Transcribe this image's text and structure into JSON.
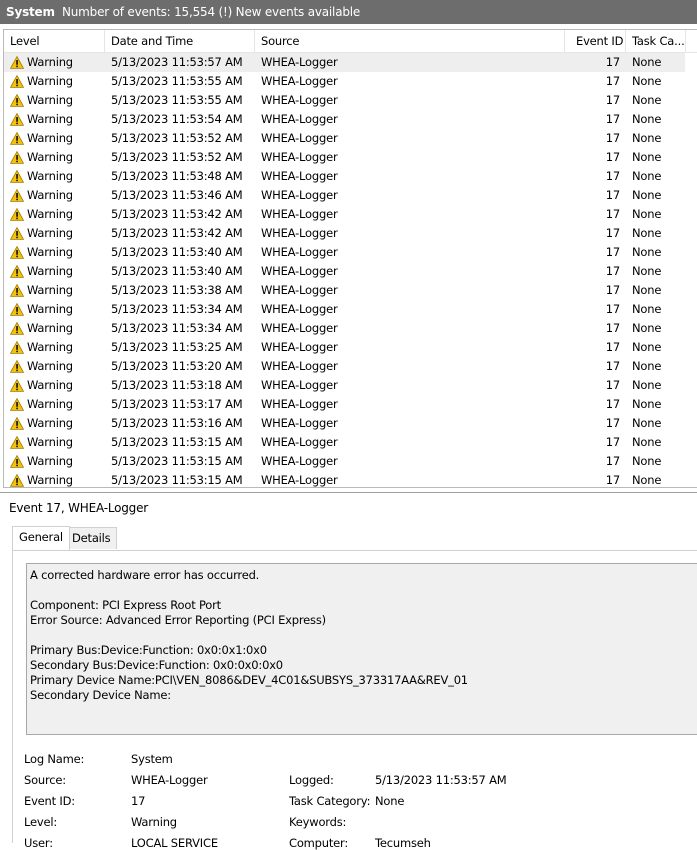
{
  "header": {
    "log_title": "System",
    "event_count_info": "Number of events: 15,554 (!) New events available"
  },
  "columns": [
    "Level",
    "Date and Time",
    "Source",
    "Event ID",
    "Task Ca..."
  ],
  "icons": {
    "warning": "warning-triangle-icon",
    "warning_color": "#f4c20d"
  },
  "events": [
    {
      "level": "Warning",
      "datetime": "5/13/2023 11:53:57 AM",
      "source": "WHEA-Logger",
      "event_id": "17",
      "task": "None"
    },
    {
      "level": "Warning",
      "datetime": "5/13/2023 11:53:55 AM",
      "source": "WHEA-Logger",
      "event_id": "17",
      "task": "None"
    },
    {
      "level": "Warning",
      "datetime": "5/13/2023 11:53:55 AM",
      "source": "WHEA-Logger",
      "event_id": "17",
      "task": "None"
    },
    {
      "level": "Warning",
      "datetime": "5/13/2023 11:53:54 AM",
      "source": "WHEA-Logger",
      "event_id": "17",
      "task": "None"
    },
    {
      "level": "Warning",
      "datetime": "5/13/2023 11:53:52 AM",
      "source": "WHEA-Logger",
      "event_id": "17",
      "task": "None"
    },
    {
      "level": "Warning",
      "datetime": "5/13/2023 11:53:52 AM",
      "source": "WHEA-Logger",
      "event_id": "17",
      "task": "None"
    },
    {
      "level": "Warning",
      "datetime": "5/13/2023 11:53:48 AM",
      "source": "WHEA-Logger",
      "event_id": "17",
      "task": "None"
    },
    {
      "level": "Warning",
      "datetime": "5/13/2023 11:53:46 AM",
      "source": "WHEA-Logger",
      "event_id": "17",
      "task": "None"
    },
    {
      "level": "Warning",
      "datetime": "5/13/2023 11:53:42 AM",
      "source": "WHEA-Logger",
      "event_id": "17",
      "task": "None"
    },
    {
      "level": "Warning",
      "datetime": "5/13/2023 11:53:42 AM",
      "source": "WHEA-Logger",
      "event_id": "17",
      "task": "None"
    },
    {
      "level": "Warning",
      "datetime": "5/13/2023 11:53:40 AM",
      "source": "WHEA-Logger",
      "event_id": "17",
      "task": "None"
    },
    {
      "level": "Warning",
      "datetime": "5/13/2023 11:53:40 AM",
      "source": "WHEA-Logger",
      "event_id": "17",
      "task": "None"
    },
    {
      "level": "Warning",
      "datetime": "5/13/2023 11:53:38 AM",
      "source": "WHEA-Logger",
      "event_id": "17",
      "task": "None"
    },
    {
      "level": "Warning",
      "datetime": "5/13/2023 11:53:34 AM",
      "source": "WHEA-Logger",
      "event_id": "17",
      "task": "None"
    },
    {
      "level": "Warning",
      "datetime": "5/13/2023 11:53:34 AM",
      "source": "WHEA-Logger",
      "event_id": "17",
      "task": "None"
    },
    {
      "level": "Warning",
      "datetime": "5/13/2023 11:53:25 AM",
      "source": "WHEA-Logger",
      "event_id": "17",
      "task": "None"
    },
    {
      "level": "Warning",
      "datetime": "5/13/2023 11:53:20 AM",
      "source": "WHEA-Logger",
      "event_id": "17",
      "task": "None"
    },
    {
      "level": "Warning",
      "datetime": "5/13/2023 11:53:18 AM",
      "source": "WHEA-Logger",
      "event_id": "17",
      "task": "None"
    },
    {
      "level": "Warning",
      "datetime": "5/13/2023 11:53:17 AM",
      "source": "WHEA-Logger",
      "event_id": "17",
      "task": "None"
    },
    {
      "level": "Warning",
      "datetime": "5/13/2023 11:53:16 AM",
      "source": "WHEA-Logger",
      "event_id": "17",
      "task": "None"
    },
    {
      "level": "Warning",
      "datetime": "5/13/2023 11:53:15 AM",
      "source": "WHEA-Logger",
      "event_id": "17",
      "task": "None"
    },
    {
      "level": "Warning",
      "datetime": "5/13/2023 11:53:15 AM",
      "source": "WHEA-Logger",
      "event_id": "17",
      "task": "None"
    },
    {
      "level": "Warning",
      "datetime": "5/13/2023 11:53:15 AM",
      "source": "WHEA-Logger",
      "event_id": "17",
      "task": "None"
    }
  ],
  "detail": {
    "title": "Event 17, WHEA-Logger",
    "tabs": [
      "General",
      "Details"
    ],
    "message_lines": [
      "A corrected hardware error has occurred.",
      "",
      "Component: PCI Express Root Port",
      "Error Source: Advanced Error Reporting (PCI Express)",
      "",
      "Primary Bus:Device:Function: 0x0:0x1:0x0",
      "Secondary Bus:Device:Function: 0x0:0x0:0x0",
      "Primary Device Name:PCI\\VEN_8086&DEV_4C01&SUBSYS_373317AA&REV_01",
      "Secondary Device Name:"
    ],
    "props": {
      "log_name_label": "Log Name:",
      "log_name_value": "System",
      "source_label": "Source:",
      "source_value": "WHEA-Logger",
      "logged_label": "Logged:",
      "logged_value": "5/13/2023 11:53:57 AM",
      "event_id_label": "Event ID:",
      "event_id_value": "17",
      "task_category_label": "Task Category:",
      "task_category_value": "None",
      "level_label": "Level:",
      "level_value": "Warning",
      "keywords_label": "Keywords:",
      "keywords_value": "",
      "user_label": "User:",
      "user_value": "LOCAL SERVICE",
      "computer_label": "Computer:",
      "computer_value": "Tecumseh"
    }
  }
}
